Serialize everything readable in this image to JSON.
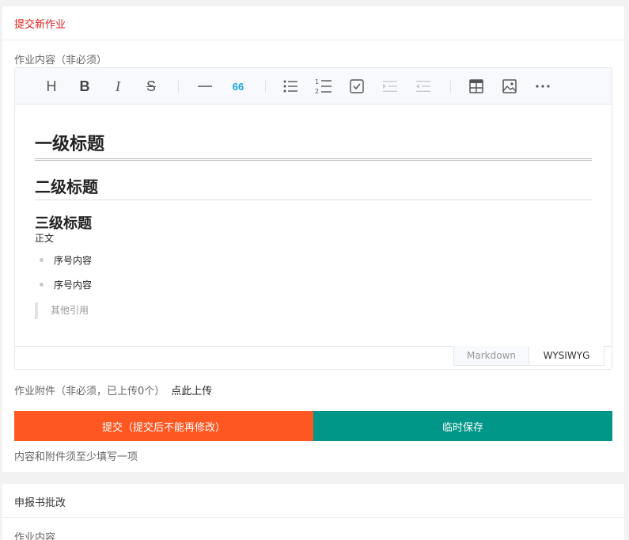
{
  "submit_card": {
    "title": "提交新作业",
    "content_label": "作业内容（非必须）",
    "toolbar": {
      "icons": [
        "heading-icon",
        "bold-icon",
        "italic-icon",
        "strike-icon",
        "hr-icon",
        "quote-icon",
        "bullet-list-icon",
        "ordered-list-icon",
        "task-list-icon",
        "indent-icon",
        "outdent-icon",
        "table-icon",
        "image-icon",
        "more-icon"
      ],
      "heading_glyph": "H",
      "bold_glyph": "B",
      "italic_glyph": "I",
      "strike_glyph": "S",
      "quote_glyph": "66"
    },
    "document": {
      "h1": "一级标题",
      "h2": "二级标题",
      "h3": "三级标题",
      "paragraph": "正文",
      "list_items": [
        "序号内容",
        "序号内容"
      ],
      "quote": "其他引用"
    },
    "mode_tabs": {
      "markdown": "Markdown",
      "wysiwyg": "WYSIWYG",
      "active": "WYSIWYG"
    },
    "attachment_label": "作业附件（非必须，已上传0个）",
    "upload_link": "点此上传",
    "submit_button": "提交（提交后不能再修改）",
    "save_button": "临时保存",
    "hint": "内容和附件须至少填写一项",
    "colors": {
      "title": "#e02020",
      "submit": "#ff5722",
      "save": "#009688",
      "quote_icon": "#1ba4e0"
    }
  },
  "review_card": {
    "title": "申报书批改",
    "content_label": "作业内容"
  }
}
